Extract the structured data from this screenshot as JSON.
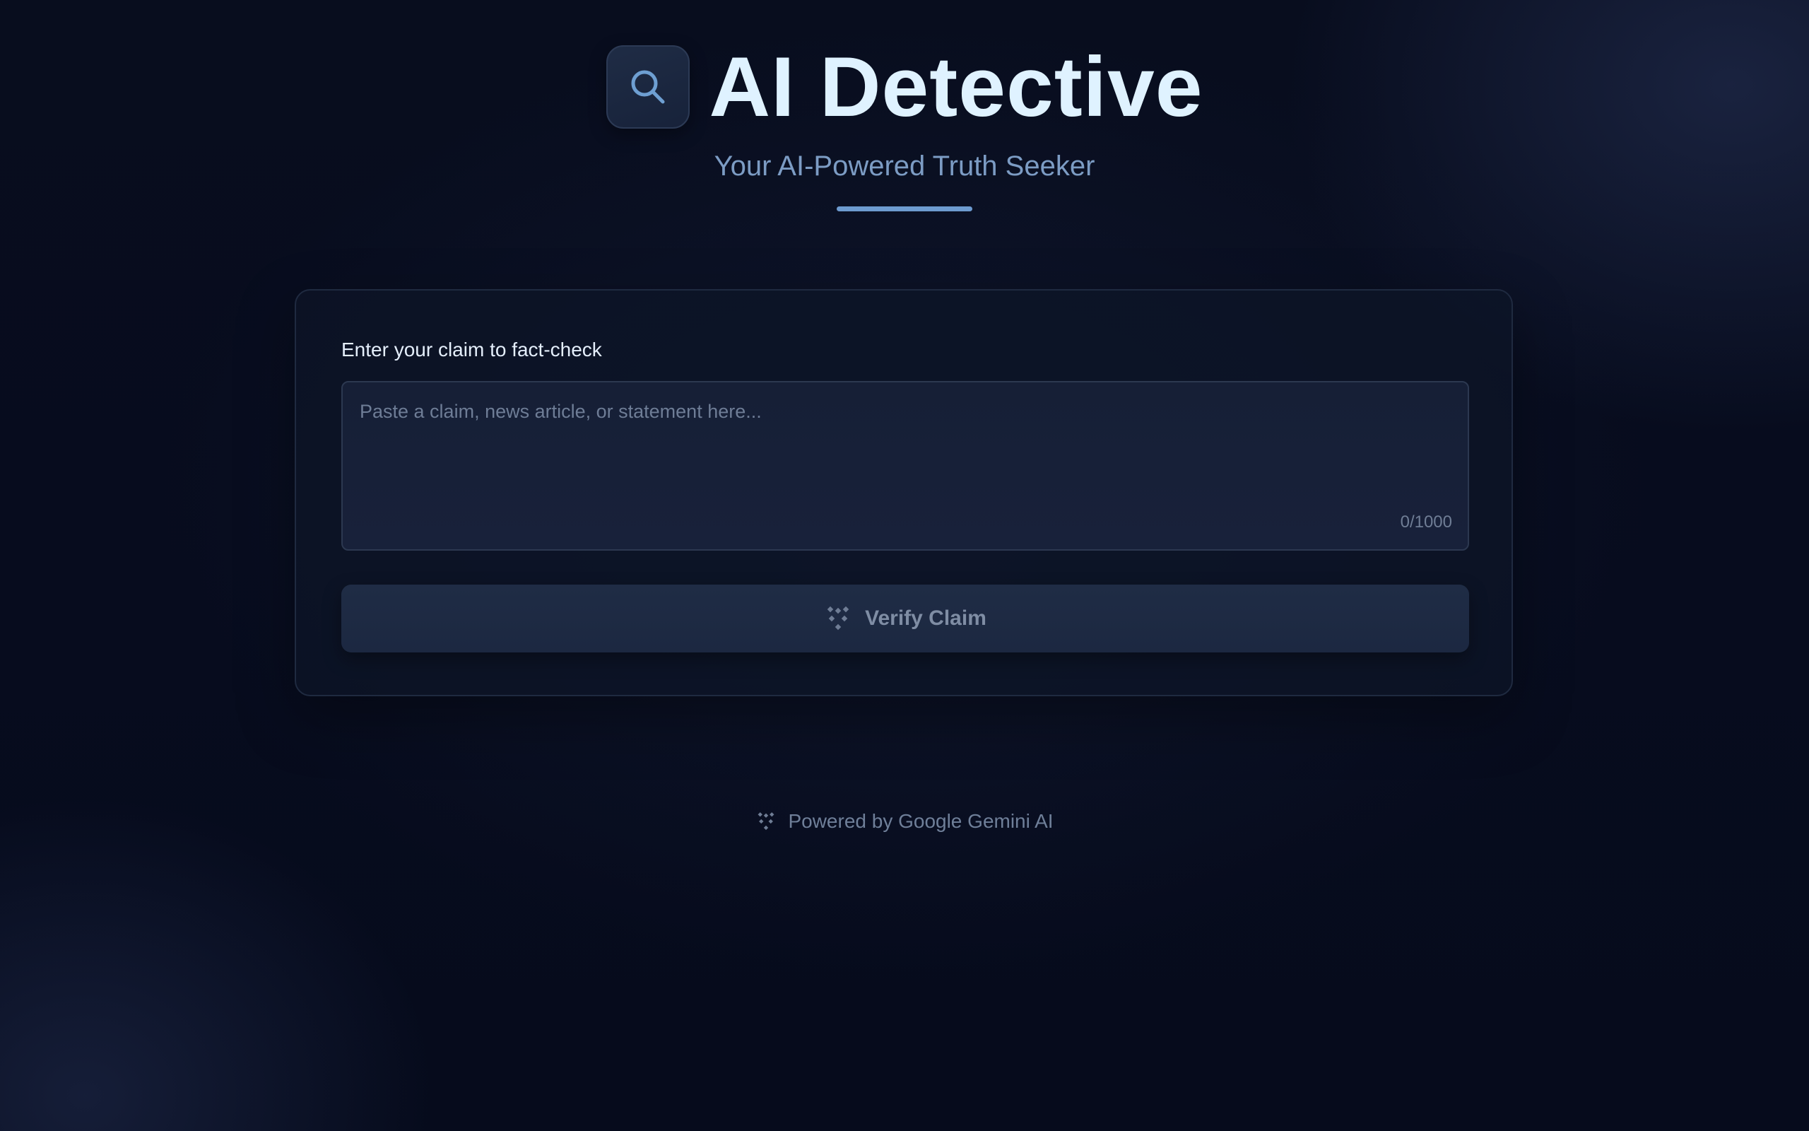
{
  "header": {
    "title": "AI Detective",
    "subtitle": "Your AI-Powered Truth Seeker",
    "logo_icon": "search-icon"
  },
  "form": {
    "label": "Enter your claim to fact-check",
    "placeholder": "Paste a claim, news article, or statement here...",
    "value": "",
    "char_count": "0/1000",
    "submit_label": "Verify Claim",
    "submit_icon": "sparkle-dots-icon"
  },
  "footer": {
    "text": "Powered by Google Gemini AI",
    "icon": "sparkle-dots-icon"
  },
  "colors": {
    "background": "#070c1e",
    "title": "#dff2ff",
    "subtitle": "#7c9cc4",
    "accent_bar": "#6d9bd0",
    "card_border": "#1f2a40",
    "button_bg": "#1f2c45",
    "button_text": "#7f8da4"
  }
}
